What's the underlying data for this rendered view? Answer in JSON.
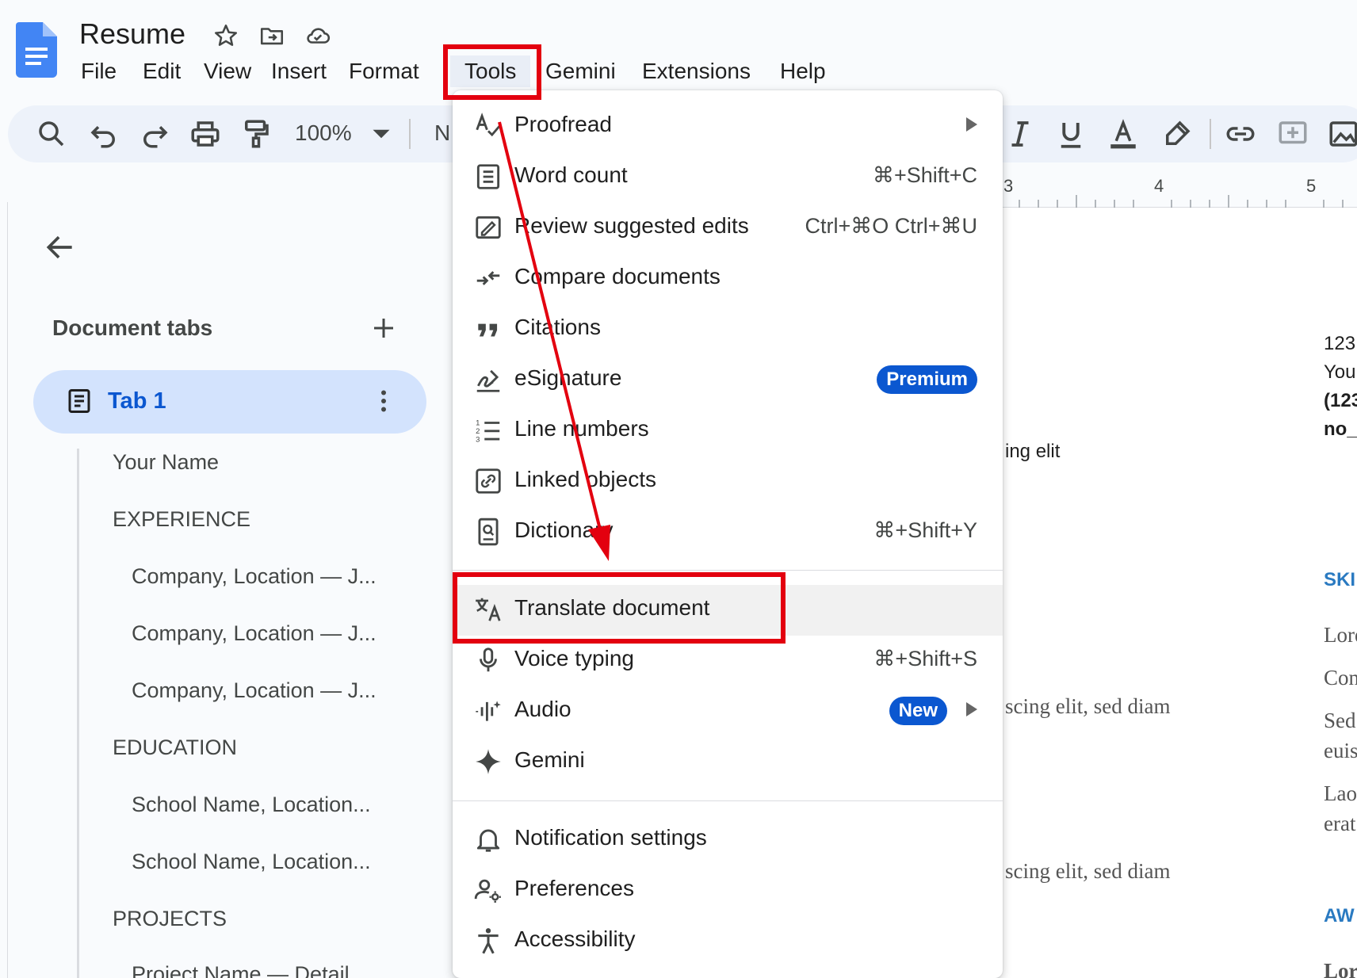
{
  "app": {
    "title": "Resume"
  },
  "menubar": {
    "items": [
      "File",
      "Edit",
      "View",
      "Insert",
      "Format",
      "Tools",
      "Gemini",
      "Extensions",
      "Help"
    ]
  },
  "toolbar": {
    "zoom": "100%",
    "style_stub": "N"
  },
  "ruler": {
    "numbers": [
      "3",
      "4",
      "5"
    ]
  },
  "sidebar": {
    "heading": "Document tabs",
    "tab_label": "Tab 1",
    "outline": [
      "Your Name",
      "EXPERIENCE",
      "Company, Location — J...",
      "Company, Location — J...",
      "Company, Location — J...",
      "EDUCATION",
      "School Name, Location...",
      "School Name, Location...",
      "PROJECTS",
      "Project Name — Detail"
    ]
  },
  "doc_peek": {
    "line1": "123",
    "line2": "You",
    "line3": "(123",
    "line4": "no_",
    "ing_elit": "ing elit",
    "skills": "SKI",
    "lor1": "Lore",
    "con": "Con",
    "sed": "Sed",
    "euis": "euis",
    "lao": "Lao",
    "erat": "erat",
    "scing1": "scing elit, sed diam",
    "scing2": "scing elit, sed diam",
    "awards": "AW",
    "lor2": "Lor"
  },
  "tools_menu": {
    "items": [
      {
        "label": "Proofread",
        "shortcut": "",
        "icon": "spellcheck-icon",
        "submenu": true
      },
      {
        "label": "Word count",
        "shortcut": "⌘+Shift+C",
        "icon": "word-count-icon"
      },
      {
        "label": "Review suggested edits",
        "shortcut": "Ctrl+⌘O Ctrl+⌘U",
        "icon": "review-edits-icon"
      },
      {
        "label": "Compare documents",
        "shortcut": "",
        "icon": "compare-icon"
      },
      {
        "label": "Citations",
        "shortcut": "",
        "icon": "quote-icon"
      },
      {
        "label": "eSignature",
        "shortcut": "",
        "icon": "signature-icon",
        "badge": "Premium"
      },
      {
        "label": "Line numbers",
        "shortcut": "",
        "icon": "line-numbers-icon"
      },
      {
        "label": "Linked objects",
        "shortcut": "",
        "icon": "linked-objects-icon"
      },
      {
        "label": "Dictionary",
        "shortcut": "⌘+Shift+Y",
        "icon": "dictionary-icon"
      },
      {
        "label": "Translate document",
        "shortcut": "",
        "icon": "translate-icon",
        "highlighted": true
      },
      {
        "label": "Voice typing",
        "shortcut": "⌘+Shift+S",
        "icon": "microphone-icon"
      },
      {
        "label": "Audio",
        "shortcut": "",
        "icon": "audio-icon",
        "badge": "New",
        "submenu": true
      },
      {
        "label": "Gemini",
        "shortcut": "",
        "icon": "sparkle-icon"
      },
      {
        "label": "Notification settings",
        "shortcut": "",
        "icon": "bell-icon"
      },
      {
        "label": "Preferences",
        "shortcut": "",
        "icon": "user-settings-icon"
      },
      {
        "label": "Accessibility",
        "shortcut": "",
        "icon": "accessibility-icon"
      }
    ]
  },
  "colors": {
    "accent": "#0b57d0",
    "annotation": "#e3000f",
    "tab_pill": "#d3e3fd",
    "toolbar_bg": "#edf2fa"
  }
}
